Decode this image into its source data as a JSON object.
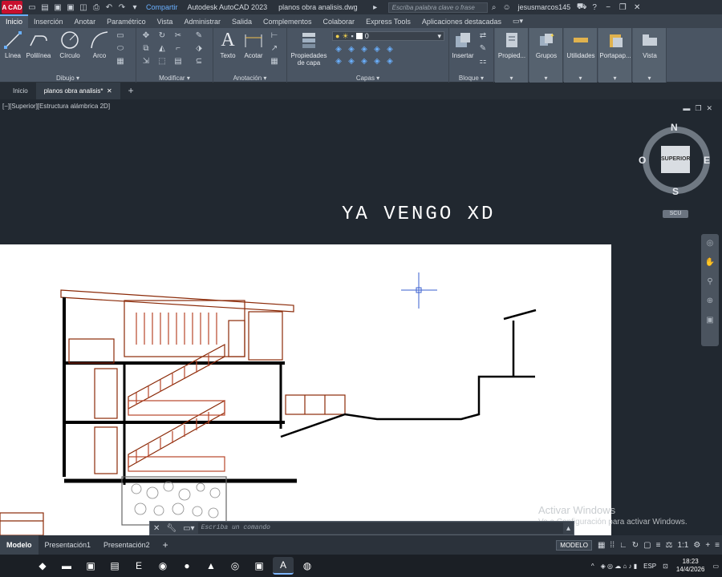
{
  "titlebar": {
    "logo": "A CAD",
    "share": "Compartir",
    "app_title": "Autodesk AutoCAD 2023",
    "file_title": "planos obra analisis.dwg",
    "search_placeholder": "Escriba palabra clave o frase",
    "user": "jesusmarcos145"
  },
  "ribbon_tabs": [
    "Inicio",
    "Inserción",
    "Anotar",
    "Paramétrico",
    "Vista",
    "Administrar",
    "Salida",
    "Complementos",
    "Colaborar",
    "Express Tools",
    "Aplicaciones destacadas"
  ],
  "ribbon": {
    "dibujo": {
      "title": "Dibujo",
      "linea": "Línea",
      "polilinea": "Polilínea",
      "circulo": "Círculo",
      "arco": "Arco"
    },
    "modificar": {
      "title": "Modificar"
    },
    "anotacion": {
      "title": "Anotación",
      "texto": "Texto",
      "acotar": "Acotar"
    },
    "capas": {
      "title": "Capas",
      "propiedades_line1": "Propiedades",
      "propiedades_line2": "de capa",
      "current_layer": "0"
    },
    "bloque": {
      "title": "Bloque",
      "insertar": "Insertar"
    },
    "propiedades": "Propied...",
    "grupos": "Grupos",
    "utilidades": "Utilidades",
    "portapapeles": "Portapap...",
    "vista": "Vista"
  },
  "file_tabs": {
    "start": "Inicio",
    "active": "planos obra analisis*"
  },
  "viewport": {
    "label": "[−][Superior][Estructura alámbrica 2D]",
    "drawing_title": "YA VENGO XD",
    "viewcube": {
      "n": "N",
      "s": "S",
      "e": "E",
      "o": "O",
      "face": "SUPERIOR",
      "scu": "SCU"
    }
  },
  "watermark": {
    "line1": "Activar Windows",
    "line2": "Ve a Configuración para activar Windows."
  },
  "command": {
    "placeholder": "Escriba un comando"
  },
  "layout_tabs": [
    "Modelo",
    "Presentación1",
    "Presentación2"
  ],
  "status": {
    "model": "MODELO",
    "scale": "1:1"
  },
  "taskbar": {
    "lang": "ESP",
    "time": "18:23",
    "date": "14/4/2026"
  },
  "colors": {
    "accent": "#6ab0ff",
    "drawing": "#8b2a08",
    "autocad_red": "#c8102e"
  }
}
